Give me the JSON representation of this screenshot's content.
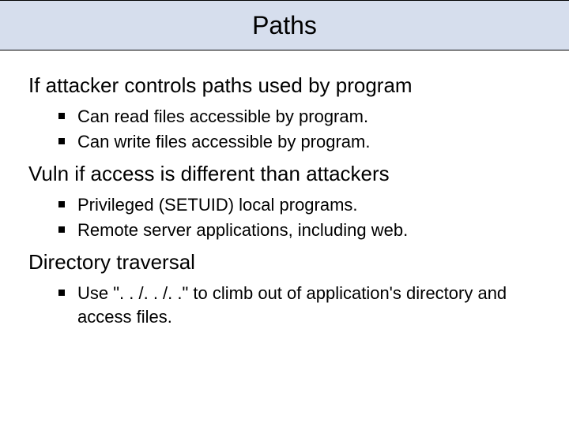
{
  "title": "Paths",
  "sections": [
    {
      "heading": "If attacker controls paths used by program",
      "bullets": [
        "Can read files accessible by program.",
        "Can write files accessible by program."
      ]
    },
    {
      "heading": "Vuln if access is different than attackers",
      "bullets": [
        "Privileged (SETUID) local programs.",
        "Remote server applications, including web."
      ]
    },
    {
      "heading": "Directory traversal",
      "bullets": [
        "Use \". . /. . /. .\" to climb out of application's directory and access files."
      ]
    }
  ]
}
